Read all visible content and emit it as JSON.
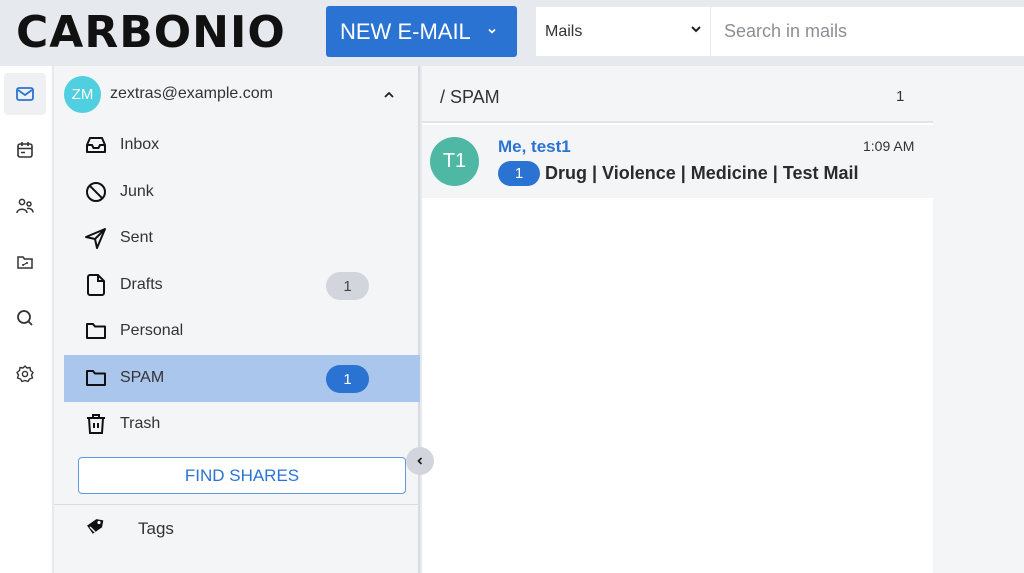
{
  "header": {
    "logo": "CARBONIO",
    "new_mail_label": "NEW E-MAIL",
    "search_module": "Mails",
    "search_placeholder": "Search in mails"
  },
  "primary_bar": {
    "items": [
      {
        "name": "mail",
        "icon": "mail-icon",
        "active": true
      },
      {
        "name": "calendar",
        "icon": "calendar-icon",
        "active": false
      },
      {
        "name": "contacts",
        "icon": "contacts-icon",
        "active": false
      },
      {
        "name": "files",
        "icon": "files-icon",
        "active": false
      },
      {
        "name": "search",
        "icon": "search-icon",
        "active": false
      },
      {
        "name": "settings",
        "icon": "gear-icon",
        "active": false
      }
    ]
  },
  "sidebar": {
    "account": {
      "initials": "ZM",
      "email": "zextras@example.com",
      "avatar_color": "#4fcfe0"
    },
    "folders": [
      {
        "label": "Inbox",
        "icon": "inbox-icon",
        "badge": null
      },
      {
        "label": "Junk",
        "icon": "junk-icon",
        "badge": null
      },
      {
        "label": "Sent",
        "icon": "sent-icon",
        "badge": null
      },
      {
        "label": "Drafts",
        "icon": "drafts-icon",
        "badge": "1"
      },
      {
        "label": "Personal",
        "icon": "folder-icon",
        "badge": null
      },
      {
        "label": "SPAM",
        "icon": "folder-icon",
        "badge": "1",
        "active": true
      },
      {
        "label": "Trash",
        "icon": "trash-icon",
        "badge": null
      }
    ],
    "find_shares_label": "FIND SHARES",
    "tags_label": "Tags"
  },
  "list": {
    "title": "/ SPAM",
    "count": "1",
    "messages": [
      {
        "avatar_initials": "T1",
        "avatar_color": "#4fb8a5",
        "sender": "Me, test1",
        "time": "1:09 AM",
        "conversation_count": "1",
        "subject": "Drug | Violence | Medicine | Test Mail"
      }
    ]
  },
  "colors": {
    "accent": "#2b73d2",
    "selected_folder": "#aac6ec"
  }
}
